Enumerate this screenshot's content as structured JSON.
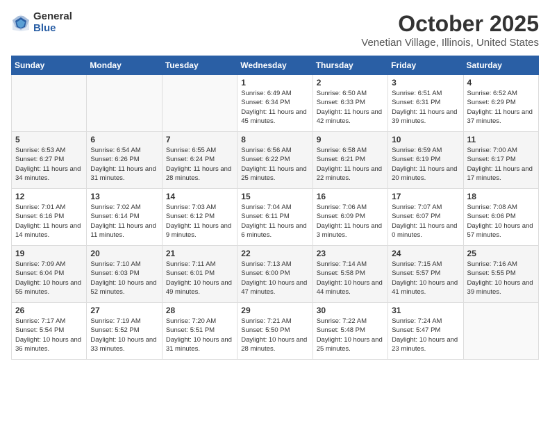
{
  "logo": {
    "general": "General",
    "blue": "Blue"
  },
  "title": "October 2025",
  "location": "Venetian Village, Illinois, United States",
  "days_of_week": [
    "Sunday",
    "Monday",
    "Tuesday",
    "Wednesday",
    "Thursday",
    "Friday",
    "Saturday"
  ],
  "weeks": [
    [
      {
        "day": "",
        "text": ""
      },
      {
        "day": "",
        "text": ""
      },
      {
        "day": "",
        "text": ""
      },
      {
        "day": "1",
        "text": "Sunrise: 6:49 AM\nSunset: 6:34 PM\nDaylight: 11 hours and 45 minutes."
      },
      {
        "day": "2",
        "text": "Sunrise: 6:50 AM\nSunset: 6:33 PM\nDaylight: 11 hours and 42 minutes."
      },
      {
        "day": "3",
        "text": "Sunrise: 6:51 AM\nSunset: 6:31 PM\nDaylight: 11 hours and 39 minutes."
      },
      {
        "day": "4",
        "text": "Sunrise: 6:52 AM\nSunset: 6:29 PM\nDaylight: 11 hours and 37 minutes."
      }
    ],
    [
      {
        "day": "5",
        "text": "Sunrise: 6:53 AM\nSunset: 6:27 PM\nDaylight: 11 hours and 34 minutes."
      },
      {
        "day": "6",
        "text": "Sunrise: 6:54 AM\nSunset: 6:26 PM\nDaylight: 11 hours and 31 minutes."
      },
      {
        "day": "7",
        "text": "Sunrise: 6:55 AM\nSunset: 6:24 PM\nDaylight: 11 hours and 28 minutes."
      },
      {
        "day": "8",
        "text": "Sunrise: 6:56 AM\nSunset: 6:22 PM\nDaylight: 11 hours and 25 minutes."
      },
      {
        "day": "9",
        "text": "Sunrise: 6:58 AM\nSunset: 6:21 PM\nDaylight: 11 hours and 22 minutes."
      },
      {
        "day": "10",
        "text": "Sunrise: 6:59 AM\nSunset: 6:19 PM\nDaylight: 11 hours and 20 minutes."
      },
      {
        "day": "11",
        "text": "Sunrise: 7:00 AM\nSunset: 6:17 PM\nDaylight: 11 hours and 17 minutes."
      }
    ],
    [
      {
        "day": "12",
        "text": "Sunrise: 7:01 AM\nSunset: 6:16 PM\nDaylight: 11 hours and 14 minutes."
      },
      {
        "day": "13",
        "text": "Sunrise: 7:02 AM\nSunset: 6:14 PM\nDaylight: 11 hours and 11 minutes."
      },
      {
        "day": "14",
        "text": "Sunrise: 7:03 AM\nSunset: 6:12 PM\nDaylight: 11 hours and 9 minutes."
      },
      {
        "day": "15",
        "text": "Sunrise: 7:04 AM\nSunset: 6:11 PM\nDaylight: 11 hours and 6 minutes."
      },
      {
        "day": "16",
        "text": "Sunrise: 7:06 AM\nSunset: 6:09 PM\nDaylight: 11 hours and 3 minutes."
      },
      {
        "day": "17",
        "text": "Sunrise: 7:07 AM\nSunset: 6:07 PM\nDaylight: 11 hours and 0 minutes."
      },
      {
        "day": "18",
        "text": "Sunrise: 7:08 AM\nSunset: 6:06 PM\nDaylight: 10 hours and 57 minutes."
      }
    ],
    [
      {
        "day": "19",
        "text": "Sunrise: 7:09 AM\nSunset: 6:04 PM\nDaylight: 10 hours and 55 minutes."
      },
      {
        "day": "20",
        "text": "Sunrise: 7:10 AM\nSunset: 6:03 PM\nDaylight: 10 hours and 52 minutes."
      },
      {
        "day": "21",
        "text": "Sunrise: 7:11 AM\nSunset: 6:01 PM\nDaylight: 10 hours and 49 minutes."
      },
      {
        "day": "22",
        "text": "Sunrise: 7:13 AM\nSunset: 6:00 PM\nDaylight: 10 hours and 47 minutes."
      },
      {
        "day": "23",
        "text": "Sunrise: 7:14 AM\nSunset: 5:58 PM\nDaylight: 10 hours and 44 minutes."
      },
      {
        "day": "24",
        "text": "Sunrise: 7:15 AM\nSunset: 5:57 PM\nDaylight: 10 hours and 41 minutes."
      },
      {
        "day": "25",
        "text": "Sunrise: 7:16 AM\nSunset: 5:55 PM\nDaylight: 10 hours and 39 minutes."
      }
    ],
    [
      {
        "day": "26",
        "text": "Sunrise: 7:17 AM\nSunset: 5:54 PM\nDaylight: 10 hours and 36 minutes."
      },
      {
        "day": "27",
        "text": "Sunrise: 7:19 AM\nSunset: 5:52 PM\nDaylight: 10 hours and 33 minutes."
      },
      {
        "day": "28",
        "text": "Sunrise: 7:20 AM\nSunset: 5:51 PM\nDaylight: 10 hours and 31 minutes."
      },
      {
        "day": "29",
        "text": "Sunrise: 7:21 AM\nSunset: 5:50 PM\nDaylight: 10 hours and 28 minutes."
      },
      {
        "day": "30",
        "text": "Sunrise: 7:22 AM\nSunset: 5:48 PM\nDaylight: 10 hours and 25 minutes."
      },
      {
        "day": "31",
        "text": "Sunrise: 7:24 AM\nSunset: 5:47 PM\nDaylight: 10 hours and 23 minutes."
      },
      {
        "day": "",
        "text": ""
      }
    ]
  ]
}
